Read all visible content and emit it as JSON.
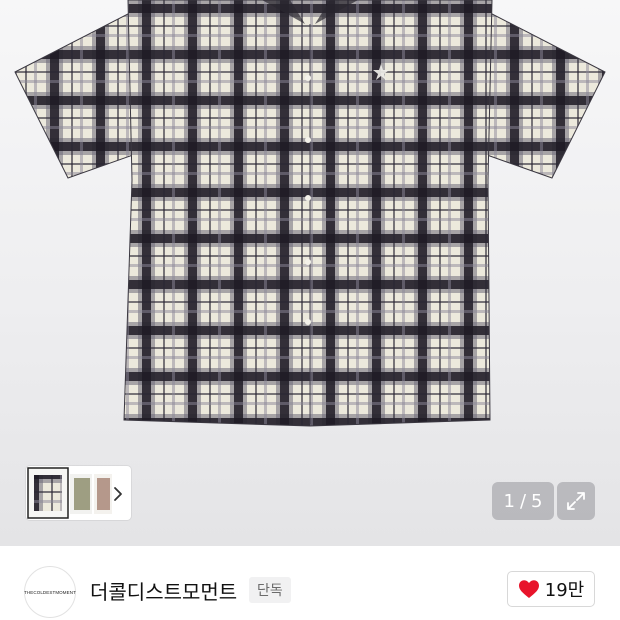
{
  "gallery": {
    "shirt_icon": "plaid-short-sleeve-shirt-photo",
    "counter": {
      "current": "1",
      "separator": "/",
      "total": "5"
    },
    "expand_icon": "expand-arrows-icon",
    "next_icon": "chevron-right-icon"
  },
  "shop": {
    "logo_text": "THECOLDESTMOMENT",
    "name": "더콜디스트모먼트",
    "badge": "단독"
  },
  "like": {
    "icon": "heart-icon",
    "count": "19만",
    "color": "#e8142b"
  },
  "colors": {
    "plaid_dark": "#23202a",
    "plaid_light": "#ece9dc",
    "plaid_mid": "#8e8c9a"
  }
}
